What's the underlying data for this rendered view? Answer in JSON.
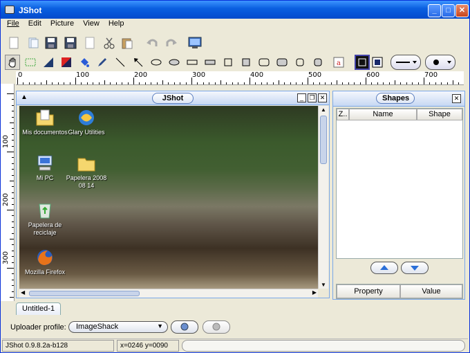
{
  "app": {
    "title": "JShot",
    "version": "JShot 0.9.8.2a-b128"
  },
  "menu": [
    "File",
    "Edit",
    "Picture",
    "View",
    "Help"
  ],
  "ruler": {
    "h_labels": [
      "0",
      "100",
      "200",
      "300",
      "400",
      "500",
      "600",
      "700"
    ],
    "v_labels": [
      "100",
      "200",
      "300"
    ]
  },
  "inner_window": {
    "title": "JShot"
  },
  "desktop_icons": [
    {
      "label": "Mis documentos",
      "icon": "folder-documents-icon"
    },
    {
      "label": "Glary Utilities",
      "icon": "glary-utilities-icon"
    },
    {
      "label": "Mi PC",
      "icon": "computer-icon"
    },
    {
      "label": "Papelera 2008 08 14",
      "icon": "folder-icon"
    },
    {
      "label": "Papelera de reciclaje",
      "icon": "recycle-bin-icon"
    },
    {
      "label": "Mozilla Firefox",
      "icon": "firefox-icon"
    }
  ],
  "shapes_panel": {
    "title": "Shapes",
    "columns": [
      "Z..",
      "Name",
      "Shape"
    ],
    "prop_columns": [
      "Property",
      "Value"
    ]
  },
  "tabs": [
    "Untitled-1"
  ],
  "uploader": {
    "label": "Uploader profile:",
    "selected": "ImageShack"
  },
  "status": {
    "coords": "x=0246 y=0090"
  }
}
